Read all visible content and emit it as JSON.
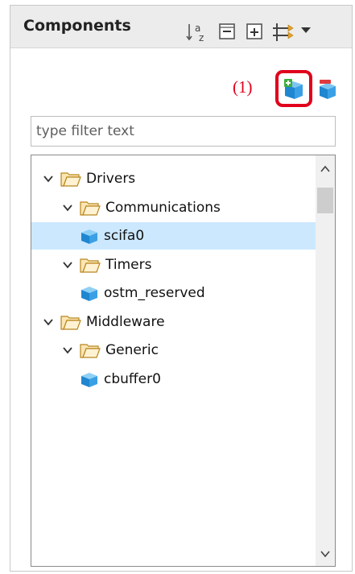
{
  "panel": {
    "title": "Components",
    "annotation": "(1)"
  },
  "filter": {
    "placeholder": "type filter text"
  },
  "tree": [
    {
      "label": "Drivers",
      "type": "folder",
      "level": 0,
      "expanded": true,
      "selected": false
    },
    {
      "label": "Communications",
      "type": "folder",
      "level": 1,
      "expanded": true,
      "selected": false
    },
    {
      "label": "scifa0",
      "type": "component",
      "level": 2,
      "selected": true
    },
    {
      "label": "Timers",
      "type": "folder",
      "level": 1,
      "expanded": true,
      "selected": false
    },
    {
      "label": "ostm_reserved",
      "type": "component",
      "level": 2,
      "selected": false
    },
    {
      "label": "Middleware",
      "type": "folder",
      "level": 0,
      "expanded": true,
      "selected": false
    },
    {
      "label": "Generic",
      "type": "folder",
      "level": 1,
      "expanded": true,
      "selected": false
    },
    {
      "label": "cbuffer0",
      "type": "component",
      "level": 2,
      "selected": false
    }
  ],
  "icons": {
    "toolbar": [
      "sort-alpha-icon",
      "collapse-all-icon",
      "expand-all-icon",
      "filter-arrows-icon",
      "view-menu-icon"
    ],
    "actions": [
      "add-component-icon",
      "remove-component-icon"
    ]
  },
  "colors": {
    "highlight": "#e0001b",
    "selection": "#cce8ff",
    "component_blue": "#2a8fd6",
    "folder_orange": "#e8a227"
  }
}
